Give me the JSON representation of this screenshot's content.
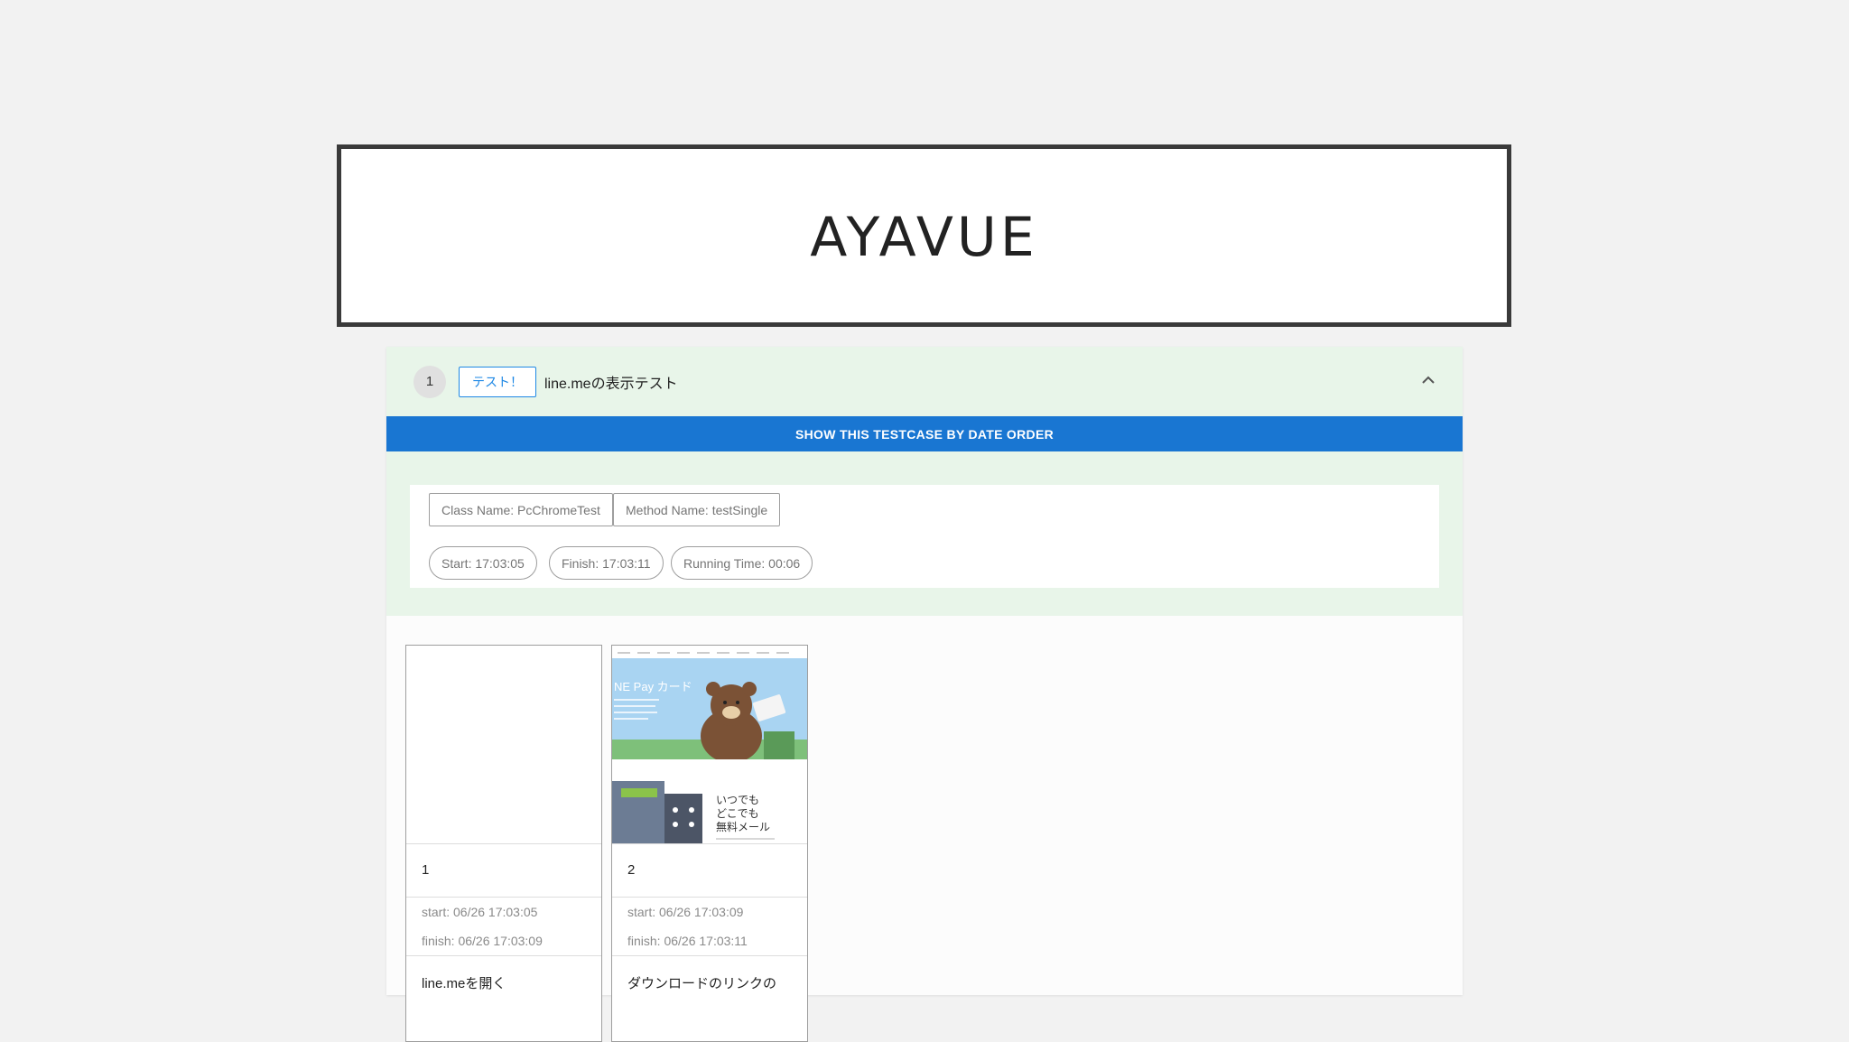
{
  "app": {
    "logo": "AYAVUE"
  },
  "testcase": {
    "number": "1",
    "tag": "テスト！",
    "title": "line.meの表示テスト",
    "date_order_button": "SHOW THIS TESTCASE BY DATE ORDER",
    "class_name": "Class Name: PcChromeTest",
    "method_name": "Method Name: testSingle",
    "start": "Start: 17:03:05",
    "finish": "Finish: 17:03:11",
    "running_time": "Running Time: 00:06"
  },
  "screenshots": [
    {
      "index": "1",
      "start": "start: 06/26 17:03:05",
      "finish": "finish: 06/26 17:03:09",
      "description": "line.meを開く"
    },
    {
      "index": "2",
      "start": "start: 06/26 17:03:09",
      "finish": "finish: 06/26 17:03:11",
      "description": "ダウンロードのリンクの",
      "thumbnail": {
        "banner_title": "NE Pay カード",
        "feature_text_1": "いつでも",
        "feature_text_2": "どこでも",
        "feature_text_3": "無料メール"
      }
    }
  ],
  "colors": {
    "accent": "#1976d2",
    "header_bg": "#e8f5e9",
    "tag": "#1e88e5",
    "page_bg": "#f2f2f2"
  },
  "icons": {
    "collapse": "chevron-up-icon"
  }
}
